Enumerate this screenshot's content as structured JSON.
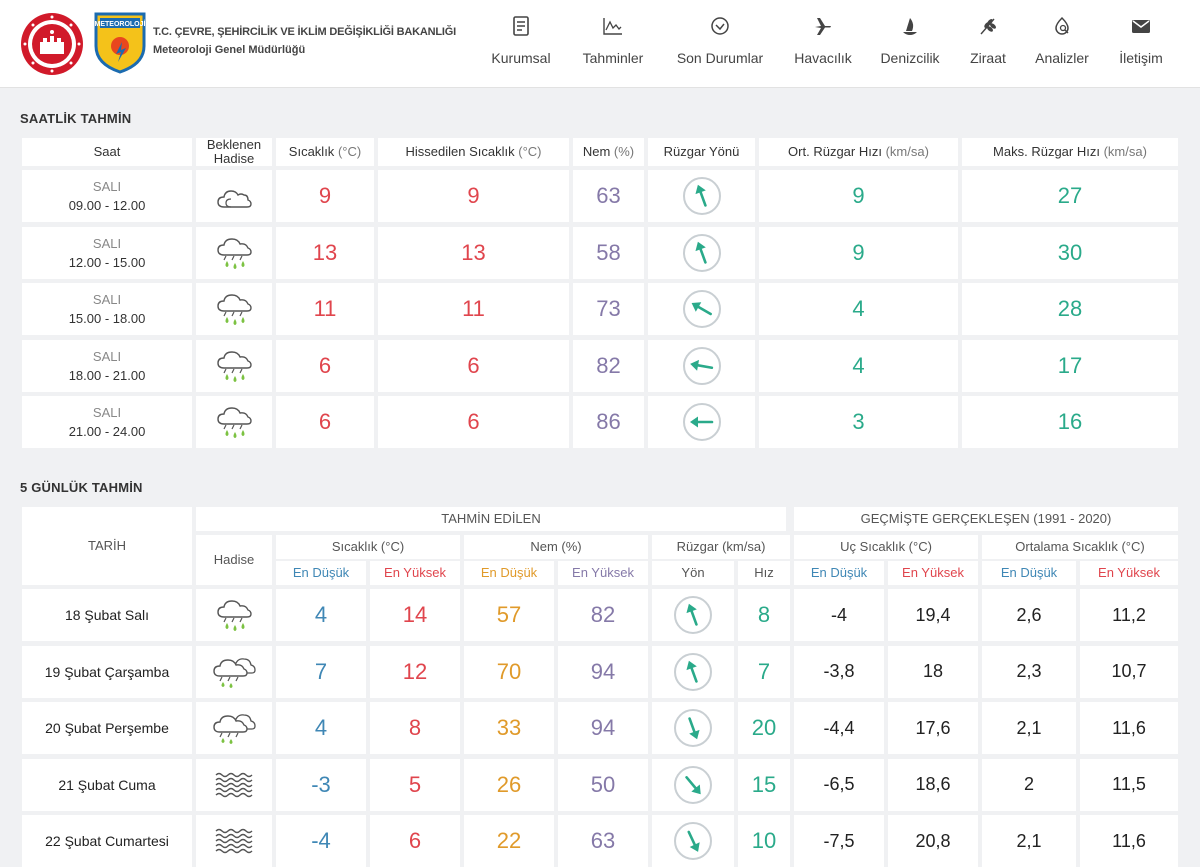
{
  "header": {
    "ministry": "T.C. ÇEVRE, ŞEHİRCİLİK VE İKLİM DEĞİŞİKLİĞİ BAKANLIĞI",
    "directorate": "Meteoroloji Genel Müdürlüğü",
    "logo_text": "METEOROLOJİ",
    "nav": [
      {
        "label": "Kurumsal",
        "icon": "document-icon"
      },
      {
        "label": "Tahminler",
        "icon": "chart-icon"
      },
      {
        "label": "Son Durumlar",
        "icon": "check-circle-icon"
      },
      {
        "label": "Havacılık",
        "icon": "airplane-icon"
      },
      {
        "label": "Denizcilik",
        "icon": "sailboat-icon"
      },
      {
        "label": "Ziraat",
        "icon": "wheat-icon"
      },
      {
        "label": "Analizler",
        "icon": "analysis-icon"
      },
      {
        "label": "İletişim",
        "icon": "envelope-icon"
      }
    ]
  },
  "hourly": {
    "title": "SAATLİK TAHMİN",
    "headers": {
      "time": "Saat",
      "event_l1": "Beklenen",
      "event_l2": "Hadise",
      "temp": "Sıcaklık",
      "temp_unit": "(°C)",
      "feels": "Hissedilen Sıcaklık",
      "feels_unit": "(°C)",
      "humidity": "Nem",
      "humidity_unit": "(%)",
      "wind_dir": "Rüzgar Yönü",
      "wind_avg": "Ort. Rüzgar Hızı",
      "wind_avg_unit": "(km/sa)",
      "wind_max": "Maks. Rüzgar Hızı",
      "wind_max_unit": "(km/sa)"
    },
    "rows": [
      {
        "day": "SALI",
        "period": "09.00 - 12.00",
        "event": "cloudy-icon",
        "temp": "9",
        "feels": "9",
        "humidity": "63",
        "wind_dir_deg": -20,
        "wind_avg": "9",
        "wind_max": "27"
      },
      {
        "day": "SALI",
        "period": "12.00 - 15.00",
        "event": "rain-icon",
        "temp": "13",
        "feels": "13",
        "humidity": "58",
        "wind_dir_deg": -20,
        "wind_avg": "9",
        "wind_max": "30"
      },
      {
        "day": "SALI",
        "period": "15.00 - 18.00",
        "event": "rain-icon",
        "temp": "11",
        "feels": "11",
        "humidity": "73",
        "wind_dir_deg": -60,
        "wind_avg": "4",
        "wind_max": "28"
      },
      {
        "day": "SALI",
        "period": "18.00 - 21.00",
        "event": "rain-icon",
        "temp": "6",
        "feels": "6",
        "humidity": "82",
        "wind_dir_deg": -80,
        "wind_avg": "4",
        "wind_max": "17"
      },
      {
        "day": "SALI",
        "period": "21.00 - 24.00",
        "event": "rain-icon",
        "temp": "6",
        "feels": "6",
        "humidity": "86",
        "wind_dir_deg": -90,
        "wind_avg": "3",
        "wind_max": "16"
      }
    ]
  },
  "daily": {
    "title": "5 GÜNLÜK TAHMİN",
    "headers": {
      "date": "TARİH",
      "forecast": "TAHMİN EDİLEN",
      "past": "GEÇMİŞTE GERÇEKLEŞEN (1991 - 2020)",
      "event": "Hadise",
      "temp": "Sıcaklık (°C)",
      "humidity": "Nem (%)",
      "wind": "Rüzgar (km/sa)",
      "extreme": "Uç Sıcaklık (°C)",
      "average": "Ortalama Sıcaklık (°C)",
      "min": "En Düşük",
      "max": "En Yüksek",
      "dir": "Yön",
      "speed": "Hız"
    },
    "rows": [
      {
        "date": "18 Şubat Salı",
        "event": "rain-icon",
        "tmin": "4",
        "tmax": "14",
        "hmin": "57",
        "hmax": "82",
        "wind_dir_deg": -20,
        "wind_speed": "8",
        "ext_min": "-4",
        "ext_max": "19,4",
        "avg_min": "2,6",
        "avg_max": "11,2"
      },
      {
        "date": "19 Şubat Çarşamba",
        "event": "rain-cloud-icon",
        "tmin": "7",
        "tmax": "12",
        "hmin": "70",
        "hmax": "94",
        "wind_dir_deg": -20,
        "wind_speed": "7",
        "ext_min": "-3,8",
        "ext_max": "18",
        "avg_min": "2,3",
        "avg_max": "10,7"
      },
      {
        "date": "20 Şubat Perşembe",
        "event": "rain-cloud-icon",
        "tmin": "4",
        "tmax": "8",
        "hmin": "33",
        "hmax": "94",
        "wind_dir_deg": 160,
        "wind_speed": "20",
        "ext_min": "-4,4",
        "ext_max": "17,6",
        "avg_min": "2,1",
        "avg_max": "11,6"
      },
      {
        "date": "21 Şubat Cuma",
        "event": "fog-icon",
        "tmin": "-3",
        "tmax": "5",
        "hmin": "26",
        "hmax": "50",
        "wind_dir_deg": 140,
        "wind_speed": "15",
        "ext_min": "-6,5",
        "ext_max": "18,6",
        "avg_min": "2",
        "avg_max": "11,5"
      },
      {
        "date": "22 Şubat Cumartesi",
        "event": "fog-icon",
        "tmin": "-4",
        "tmax": "6",
        "hmin": "22",
        "hmax": "63",
        "wind_dir_deg": 155,
        "wind_speed": "10",
        "ext_min": "-7,5",
        "ext_max": "20,8",
        "avg_min": "2,1",
        "avg_max": "11,6"
      }
    ]
  }
}
